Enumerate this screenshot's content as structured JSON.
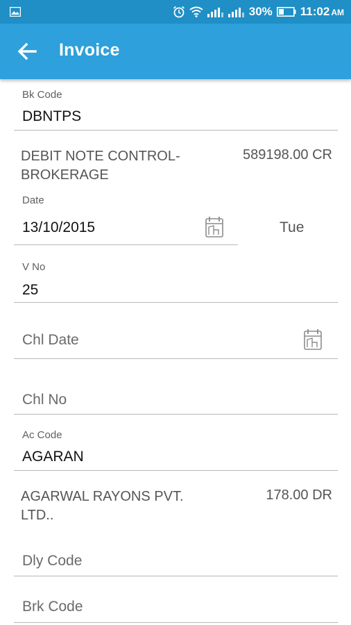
{
  "status_bar": {
    "battery": "30%",
    "time": "11:02",
    "ampm": "AM",
    "icons": [
      "image-icon",
      "alarm-icon",
      "wifi-icon",
      "signal-icon",
      "signal-icon",
      "battery-icon"
    ]
  },
  "app_bar": {
    "title": "Invoice",
    "back_icon": "arrow-left-icon",
    "color": "#2ea0db"
  },
  "form": {
    "bk_code": {
      "label": "Bk Code",
      "value": "DBNTPS"
    },
    "bk_desc": {
      "line1": "DEBIT NOTE CONTROL-",
      "line2": "BROKERAGE",
      "amount": "589198.00 CR"
    },
    "date": {
      "label": "Date",
      "value": "13/10/2015",
      "day": "Tue"
    },
    "v_no": {
      "label": "V No",
      "value": "25"
    },
    "chl_date": {
      "placeholder": "Chl Date"
    },
    "chl_no": {
      "placeholder": "Chl No"
    },
    "ac_code": {
      "label": "Ac Code",
      "value": "AGARAN"
    },
    "ac_desc": {
      "line1": "AGARWAL RAYONS PVT.",
      "line2": "LTD..",
      "amount": "178.00 DR"
    },
    "dly_code": {
      "placeholder": "Dly Code"
    },
    "brk_code": {
      "placeholder": "Brk Code"
    }
  }
}
